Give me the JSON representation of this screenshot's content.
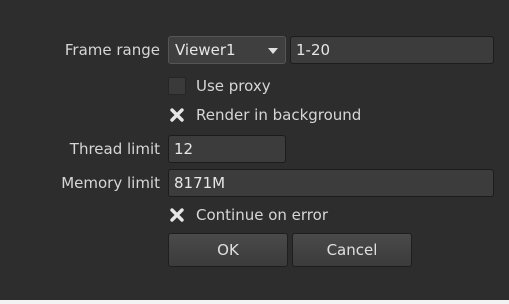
{
  "frame_range": {
    "label": "Frame range",
    "dropdown_value": "Viewer1",
    "value": "1-20"
  },
  "use_proxy": {
    "label": "Use proxy",
    "checked": false
  },
  "render_background": {
    "label": "Render in background",
    "checked": true
  },
  "thread_limit": {
    "label": "Thread limit",
    "value": "12"
  },
  "memory_limit": {
    "label": "Memory limit",
    "value": "8171M"
  },
  "continue_on_error": {
    "label": "Continue on error",
    "checked": true
  },
  "buttons": {
    "ok": "OK",
    "cancel": "Cancel"
  }
}
